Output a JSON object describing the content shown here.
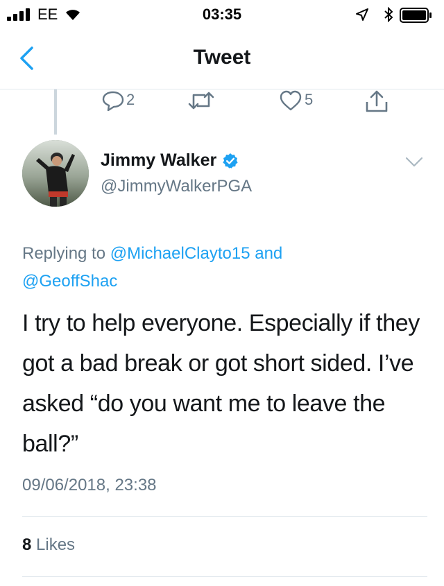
{
  "status_bar": {
    "carrier": "EE",
    "time": "03:35"
  },
  "nav": {
    "title": "Tweet"
  },
  "parent_actions": {
    "reply_count": "2",
    "like_count": "5"
  },
  "tweet": {
    "author_name": "Jimmy Walker",
    "author_handle": "@JimmyWalkerPGA",
    "replying_prefix": "Replying to",
    "replying_mention_1": "@MichaelClayto15",
    "replying_and": "and",
    "replying_mention_2": "@GeoffShac",
    "text": "I try to help everyone. Especially if they got a bad break or got short sided. I’ve asked “do you want me to leave the ball?”",
    "timestamp": "09/06/2018, 23:38",
    "likes_count": "8",
    "likes_label": "Likes"
  },
  "colors": {
    "accent": "#1da1f2",
    "secondary_text": "#657786",
    "divider": "#e1e8ed"
  }
}
